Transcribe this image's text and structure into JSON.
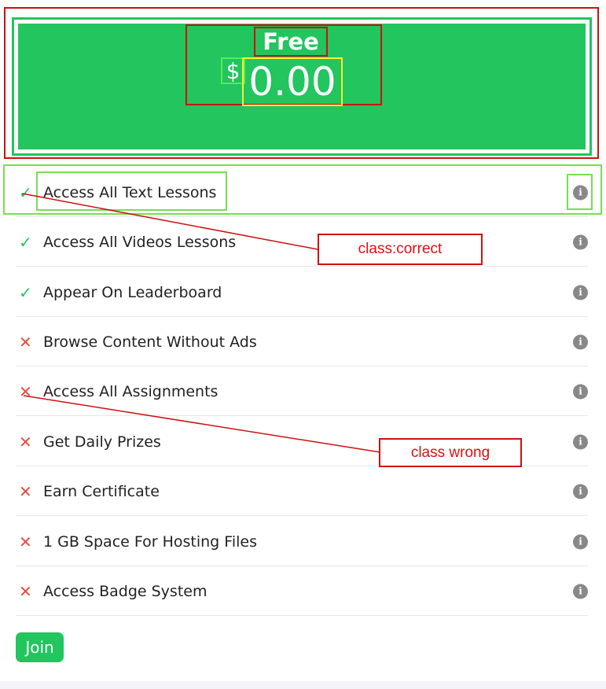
{
  "plan": {
    "name": "Free",
    "currency": "$",
    "amount": "0.00"
  },
  "features": [
    {
      "label": "Access All Text Lessons",
      "included": true
    },
    {
      "label": "Access All Videos Lessons",
      "included": true
    },
    {
      "label": "Appear On Leaderboard",
      "included": true
    },
    {
      "label": "Browse Content Without Ads",
      "included": false
    },
    {
      "label": "Access All Assignments",
      "included": false
    },
    {
      "label": "Get Daily Prizes",
      "included": false
    },
    {
      "label": "Earn Certificate",
      "included": false
    },
    {
      "label": "1 GB Space For Hosting Files",
      "included": false
    },
    {
      "label": "Access Badge System",
      "included": false
    }
  ],
  "icons": {
    "included": "check-icon",
    "excluded": "cross-icon",
    "info": "info-icon"
  },
  "annotations": {
    "correct_label": "class:correct",
    "wrong_label": "class wrong"
  },
  "join_label": "Join",
  "colors": {
    "accent": "#22c55e",
    "excluded": "#e74c3c",
    "annotation": "#cc1111"
  }
}
